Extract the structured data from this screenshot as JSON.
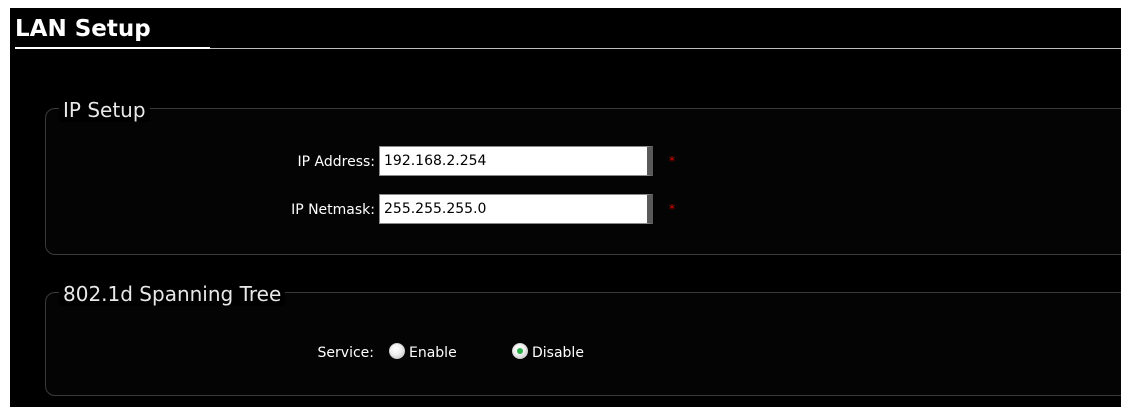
{
  "page": {
    "title": "LAN Setup"
  },
  "ip_setup": {
    "legend": "IP Setup",
    "ip_address": {
      "label": "IP Address:",
      "value": "192.168.2.254",
      "required_mark": "*"
    },
    "ip_netmask": {
      "label": "IP Netmask:",
      "value": "255.255.255.0",
      "required_mark": "*"
    }
  },
  "spanning_tree": {
    "legend": "802.1d Spanning Tree",
    "service": {
      "label": "Service:",
      "options": [
        {
          "label": "Enable",
          "selected": false
        },
        {
          "label": "Disable",
          "selected": true
        }
      ]
    }
  },
  "colors": {
    "background": "#000000",
    "text": "#ffffff",
    "required": "#e00000",
    "radio_selected": "#2db14a"
  }
}
